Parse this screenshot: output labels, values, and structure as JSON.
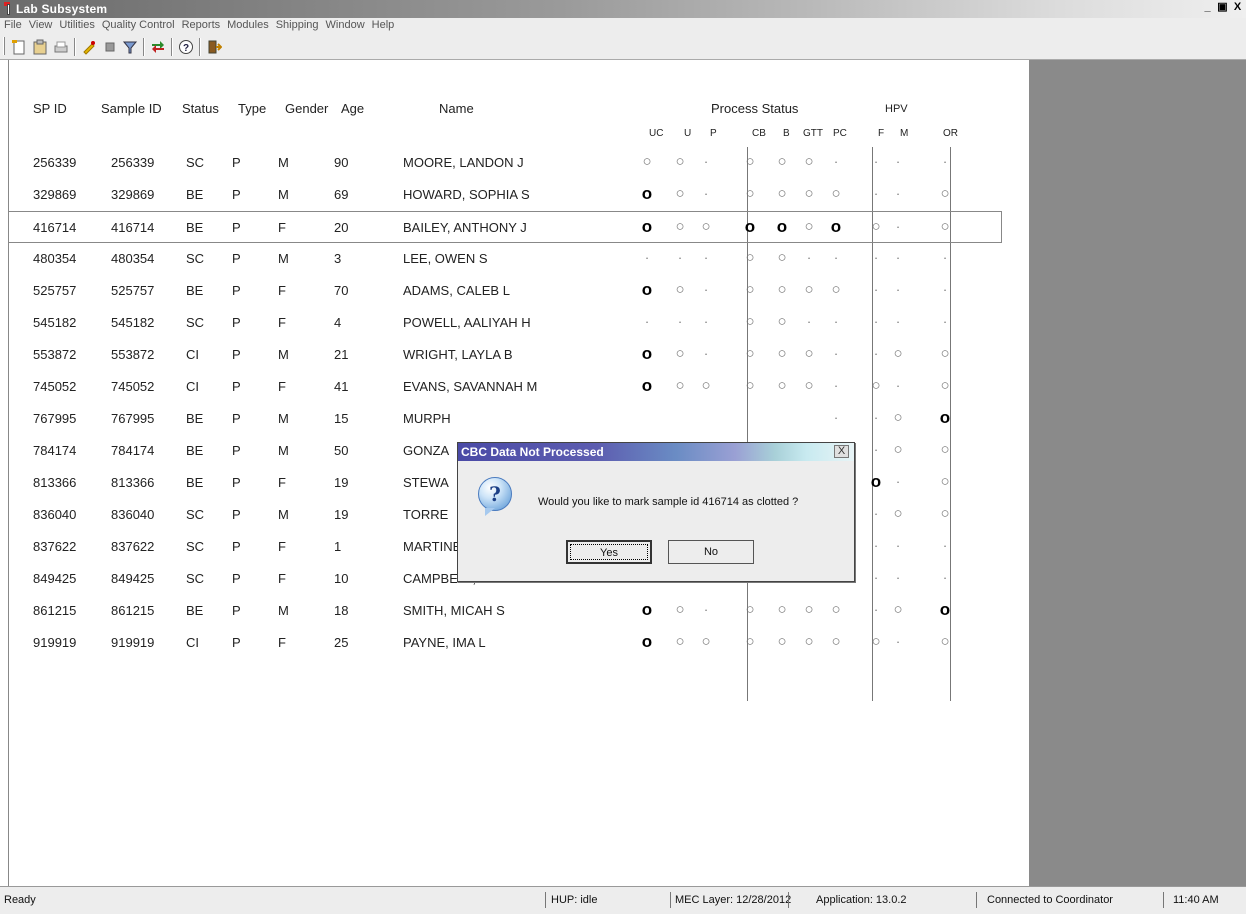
{
  "window": {
    "title": "Lab Subsystem",
    "controls": [
      "_",
      "Ѧ",
      "X"
    ]
  },
  "menu": [
    "File",
    "View",
    "Utilities",
    "Quality Control",
    "Reports",
    "Modules",
    "Shipping",
    "Window",
    "Help"
  ],
  "toolbar": {
    "icons": [
      "new-icon",
      "clipboard-icon",
      "print-icon",
      "edit-icon",
      "stop-icon",
      "filter-icon",
      "transfer-icon",
      "help-icon",
      "exit-icon"
    ]
  },
  "grid": {
    "headers": {
      "spid": "SP ID",
      "sample": "Sample ID",
      "status": "Status",
      "type": "Type",
      "gender": "Gender",
      "age": "Age",
      "name": "Name",
      "process_status": "Process Status",
      "hpv": "HPV"
    },
    "subheaders": [
      "UC",
      "U",
      "P",
      "CB",
      "B",
      "GTT",
      "PC",
      "F",
      "M",
      "OR"
    ],
    "rows": [
      {
        "spid": "256339",
        "sample": "256339",
        "status": "SC",
        "type": "P",
        "gender": "M",
        "age": "90",
        "name": "MOORE, LANDON J",
        "marks": [
          "o",
          "o",
          ".",
          "o",
          "o",
          "o",
          ".",
          ".",
          ".",
          "."
        ]
      },
      {
        "spid": "329869",
        "sample": "329869",
        "status": "BE",
        "type": "P",
        "gender": "M",
        "age": "69",
        "name": "HOWARD, SOPHIA S",
        "marks": [
          "O",
          "o",
          ".",
          "o",
          "o",
          "o",
          "o",
          ".",
          ".",
          "o"
        ]
      },
      {
        "spid": "416714",
        "sample": "416714",
        "status": "BE",
        "type": "P",
        "gender": "F",
        "age": "20",
        "name": "BAILEY, ANTHONY J",
        "selected": true,
        "marks": [
          "O",
          "o",
          "o",
          "O",
          "O",
          "o",
          "O",
          "o",
          ".",
          "o"
        ]
      },
      {
        "spid": "480354",
        "sample": "480354",
        "status": "SC",
        "type": "P",
        "gender": "M",
        "age": "3",
        "name": "LEE, OWEN S",
        "marks": [
          ".",
          ".",
          ".",
          "o",
          "o",
          ".",
          ".",
          ".",
          ".",
          "."
        ]
      },
      {
        "spid": "525757",
        "sample": "525757",
        "status": "BE",
        "type": "P",
        "gender": "F",
        "age": "70",
        "name": "ADAMS, CALEB L",
        "marks": [
          "O",
          "o",
          ".",
          "o",
          "o",
          "o",
          "o",
          ".",
          ".",
          "."
        ]
      },
      {
        "spid": "545182",
        "sample": "545182",
        "status": "SC",
        "type": "P",
        "gender": "F",
        "age": "4",
        "name": "POWELL, AALIYAH H",
        "marks": [
          ".",
          ".",
          ".",
          "o",
          "o",
          ".",
          ".",
          ".",
          ".",
          "."
        ]
      },
      {
        "spid": "553872",
        "sample": "553872",
        "status": "CI",
        "type": "P",
        "gender": "M",
        "age": "21",
        "name": "WRIGHT, LAYLA B",
        "marks": [
          "O",
          "o",
          ".",
          "o",
          "o",
          "o",
          ".",
          ".",
          "o",
          "o"
        ]
      },
      {
        "spid": "745052",
        "sample": "745052",
        "status": "CI",
        "type": "P",
        "gender": "F",
        "age": "41",
        "name": "EVANS, SAVANNAH M",
        "marks": [
          "O",
          "o",
          "o",
          "o",
          "o",
          "o",
          ".",
          "o",
          ".",
          "o"
        ]
      },
      {
        "spid": "767995",
        "sample": "767995",
        "status": "BE",
        "type": "P",
        "gender": "M",
        "age": "15",
        "name": "MURPH",
        "marks": [
          "",
          "",
          "",
          "",
          "",
          "",
          ".",
          ".",
          "o",
          "O"
        ]
      },
      {
        "spid": "784174",
        "sample": "784174",
        "status": "BE",
        "type": "P",
        "gender": "M",
        "age": "50",
        "name": "GONZA",
        "marks": [
          "",
          "",
          "",
          "",
          "",
          "",
          ".",
          ".",
          "o",
          "o"
        ]
      },
      {
        "spid": "813366",
        "sample": "813366",
        "status": "BE",
        "type": "P",
        "gender": "F",
        "age": "19",
        "name": "STEWA",
        "marks": [
          "",
          "",
          "",
          "",
          "",
          "",
          ".",
          "O",
          ".",
          "o"
        ]
      },
      {
        "spid": "836040",
        "sample": "836040",
        "status": "SC",
        "type": "P",
        "gender": "M",
        "age": "19",
        "name": "TORRE",
        "marks": [
          "",
          "",
          "",
          "",
          "",
          "",
          ".",
          ".",
          "o",
          "o"
        ]
      },
      {
        "spid": "837622",
        "sample": "837622",
        "status": "SC",
        "type": "P",
        "gender": "F",
        "age": "1",
        "name": "MARTINEZ, ANNA L",
        "marks": [
          ".",
          ".",
          ".",
          "o",
          "o",
          ".",
          ".",
          ".",
          ".",
          "."
        ]
      },
      {
        "spid": "849425",
        "sample": "849425",
        "status": "SC",
        "type": "P",
        "gender": "F",
        "age": "10",
        "name": "CAMPBELL, JASPER N",
        "marks": [
          "o",
          "o",
          "o",
          "o",
          "o",
          ".",
          "o",
          ".",
          ".",
          "."
        ]
      },
      {
        "spid": "861215",
        "sample": "861215",
        "status": "BE",
        "type": "P",
        "gender": "M",
        "age": "18",
        "name": "SMITH, MICAH S",
        "marks": [
          "O",
          "o",
          ".",
          "o",
          "o",
          "o",
          "o",
          ".",
          "o",
          "O"
        ]
      },
      {
        "spid": "919919",
        "sample": "919919",
        "status": "CI",
        "type": "P",
        "gender": "F",
        "age": "25",
        "name": "PAYNE, IMA L",
        "marks": [
          "O",
          "o",
          "o",
          "o",
          "o",
          "o",
          "o",
          "o",
          ".",
          "o"
        ]
      }
    ]
  },
  "dialog": {
    "title": "CBC Data Not Processed",
    "close": "X",
    "icon": "question-icon",
    "message": "Would you like to mark sample id 416714 as clotted ?",
    "yes": "Yes",
    "no": "No"
  },
  "statusbar": {
    "ready": "Ready",
    "hup": "HUP: idle",
    "layer": "MEC Layer: 12/28/2012",
    "app": "Application: 13.0.2",
    "conn": "Connected to Coordinator",
    "time": "11:40 AM"
  }
}
